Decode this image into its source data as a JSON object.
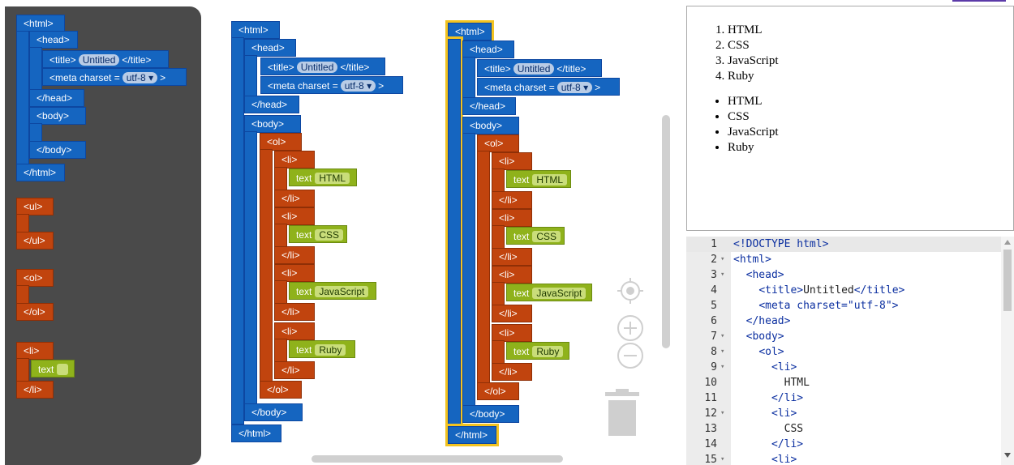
{
  "toolbox": {
    "html_open": "<html>",
    "head_open": "<head>",
    "title_open": "<title>",
    "title_value": "Untitled",
    "title_close": "</title>",
    "meta_label": "<meta charset =",
    "meta_value": "utf-8",
    "meta_close": ">",
    "head_close": "</head>",
    "body_open": "<body>",
    "body_close": "</body>",
    "html_close": "</html>",
    "ul_open": "<ul>",
    "ul_close": "</ul>",
    "ol_open": "<ol>",
    "ol_close": "</ol>",
    "li_open": "<li>",
    "li_close": "</li>",
    "text_label": "text"
  },
  "workspace": {
    "dropdown_arrow": "▾",
    "list_items": [
      "HTML",
      "CSS",
      "JavaScript",
      "Ruby"
    ]
  },
  "preview": {
    "ordered": [
      "HTML",
      "CSS",
      "JavaScript",
      "Ruby"
    ],
    "unordered": [
      "HTML",
      "CSS",
      "JavaScript",
      "Ruby"
    ]
  },
  "code": {
    "lines": [
      {
        "n": "1",
        "fold": "",
        "text": "<!DOCTYPE html>"
      },
      {
        "n": "2",
        "fold": "▾",
        "text": "<html>"
      },
      {
        "n": "3",
        "fold": "▾",
        "text": "  <head>"
      },
      {
        "n": "4",
        "fold": "",
        "text": "    <title>Untitled</title>"
      },
      {
        "n": "5",
        "fold": "",
        "text": "    <meta charset=\"utf-8\">"
      },
      {
        "n": "6",
        "fold": "",
        "text": "  </head>"
      },
      {
        "n": "7",
        "fold": "▾",
        "text": "  <body>"
      },
      {
        "n": "8",
        "fold": "▾",
        "text": "    <ol>"
      },
      {
        "n": "9",
        "fold": "▾",
        "text": "      <li>"
      },
      {
        "n": "10",
        "fold": "",
        "text": "        HTML"
      },
      {
        "n": "11",
        "fold": "",
        "text": "      </li>"
      },
      {
        "n": "12",
        "fold": "▾",
        "text": "      <li>"
      },
      {
        "n": "13",
        "fold": "",
        "text": "        CSS"
      },
      {
        "n": "14",
        "fold": "",
        "text": "      </li>"
      },
      {
        "n": "15",
        "fold": "▾",
        "text": "      <li>"
      }
    ]
  },
  "colors": {
    "structure_block": "#1565c0",
    "list_block": "#c1440e",
    "text_block": "#8fb21b",
    "selection": "#f2c320",
    "toolbox_bg": "#4a4a4a"
  },
  "icons": [
    "recenter-icon",
    "zoom-in-icon",
    "zoom-out-icon",
    "trash-icon"
  ]
}
